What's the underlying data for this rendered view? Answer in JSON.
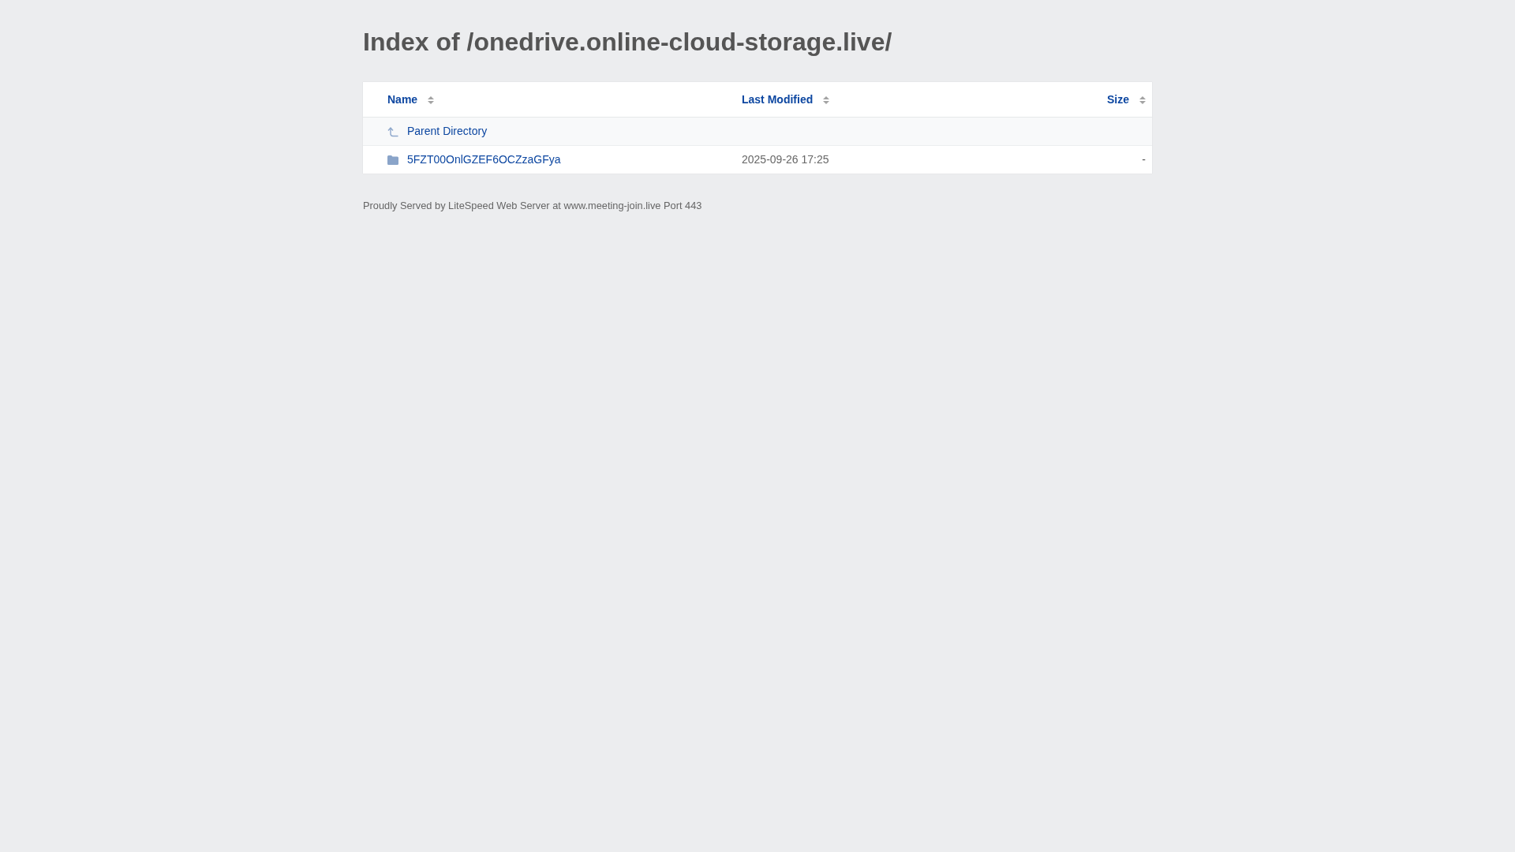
{
  "title": "Index of /onedrive.online-cloud-storage.live/",
  "table": {
    "columns": [
      {
        "label": "Name"
      },
      {
        "label": "Last Modified"
      },
      {
        "label": "Size"
      }
    ],
    "rows": [
      {
        "kind": "parent",
        "name": "Parent Directory"
      },
      {
        "kind": "folder",
        "name": "5FZT00OnlGZEF6OCZzaGFya",
        "modified": "2025-09-26 17:25",
        "size": "-"
      }
    ]
  },
  "footer": "Proudly Served by LiteSpeed Web Server at www.meeting-join.live Port 443"
}
